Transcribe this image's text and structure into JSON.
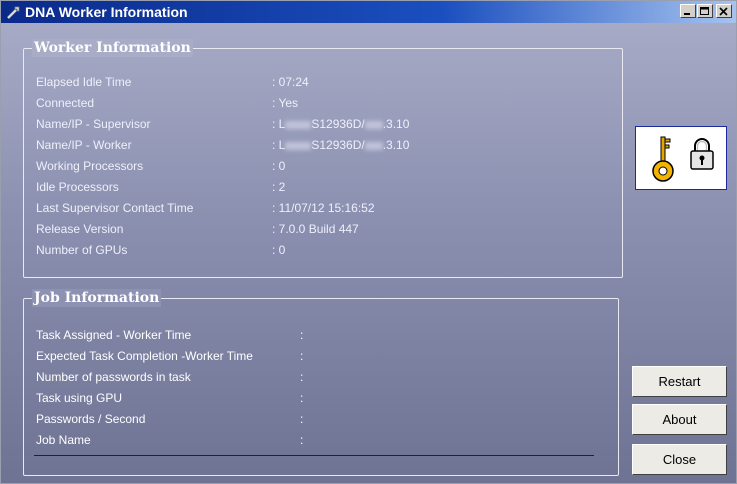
{
  "window": {
    "title": "DNA Worker Information"
  },
  "worker_info": {
    "heading": "Worker Information",
    "rows": [
      {
        "label": "Elapsed Idle Time",
        "value": ": 07:24"
      },
      {
        "label": "Connected",
        "value": ": Yes"
      },
      {
        "label": "Name/IP - Supervisor",
        "value_prefix": ": L",
        "value_mid": "S12936D/",
        "value_suffix": ".3.10"
      },
      {
        "label": "Name/IP - Worker",
        "value_prefix": ": L",
        "value_mid": "S12936D/",
        "value_suffix": ".3.10"
      },
      {
        "label": "Working Processors",
        "value": ": 0"
      },
      {
        "label": "Idle Processors",
        "value": ": 2"
      },
      {
        "label": "Last Supervisor Contact Time",
        "value": ": 11/07/12  15:16:52"
      },
      {
        "label": "Release Version",
        "value": ": 7.0.0 Build 447"
      },
      {
        "label": "Number of GPUs",
        "value": ": 0"
      }
    ]
  },
  "job_info": {
    "heading": "Job Information",
    "rows": [
      {
        "label": "Task Assigned - Worker Time",
        "value": ":"
      },
      {
        "label": "Expected Task Completion -Worker Time",
        "value": ":"
      },
      {
        "label": "Number of passwords in task",
        "value": ":"
      },
      {
        "label": "Task using GPU",
        "value": ":"
      },
      {
        "label": "Passwords / Second",
        "value": ":"
      },
      {
        "label": "Job Name",
        "value": ":"
      }
    ]
  },
  "buttons": {
    "restart": "Restart",
    "about": "About",
    "close": "Close"
  },
  "icons": {
    "title": "tools-icon",
    "key": "key-icon",
    "lock": "padlock-icon"
  },
  "colors": {
    "title_bar": "#0a2a8a",
    "panel_bg": "#8b90b0",
    "key": "#f0b400"
  }
}
